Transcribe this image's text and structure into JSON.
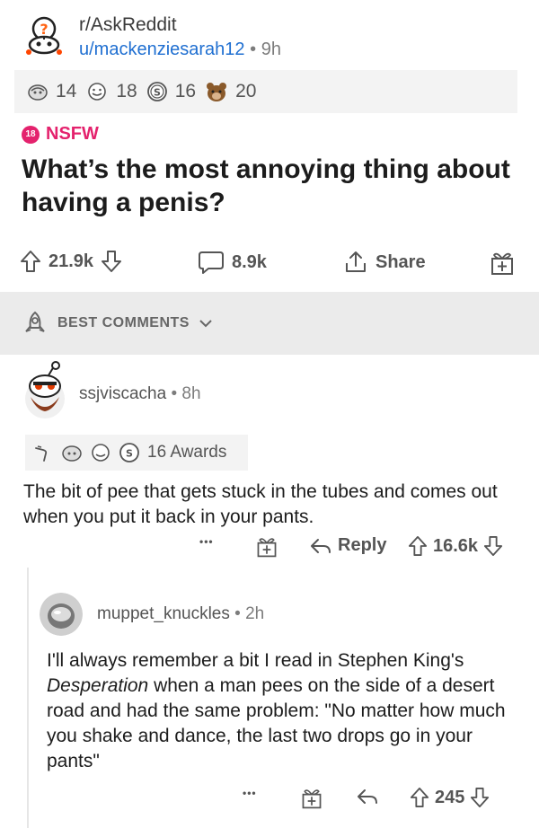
{
  "post": {
    "subreddit": "r/AskReddit",
    "author": "u/mackenziesarah12",
    "separator": "•",
    "age": "9h",
    "awards": [
      {
        "icon": "silver-award-icon",
        "count": "14"
      },
      {
        "icon": "wholesome-award-icon",
        "count": "18"
      },
      {
        "icon": "coin-award-icon",
        "count": "16"
      },
      {
        "icon": "bear-award-icon",
        "count": "20"
      }
    ],
    "nsfw_badge": "18",
    "nsfw_label": "NSFW",
    "title": "What’s the most annoying thing about having a penis?",
    "upvotes": "21.9k",
    "comments": "8.9k",
    "share_label": "Share"
  },
  "sort": {
    "label": "BEST COMMENTS"
  },
  "comment1": {
    "author": "ssjviscacha",
    "separator": "•",
    "age": "8h",
    "awards_label": "16 Awards",
    "body": "The bit of pee that gets stuck in the tubes and comes out when you put it back in your pants.",
    "more": "•••",
    "reply_label": "Reply",
    "score": "16.6k"
  },
  "comment2": {
    "author": "muppet_knuckles",
    "separator": "•",
    "age": "2h",
    "body_before": "I'll always remember a bit I read in Stephen King's ",
    "body_italic": "Desperation",
    "body_after": " when a man pees on the side of a desert road and had the same problem: \"No matter how much you shake and dance, the last two drops go in your pants\"",
    "more": "•••",
    "score": "245"
  },
  "colors": {
    "accent_blue": "#1f6fd1",
    "nsfw_pink": "#e4226d",
    "band_gray": "#ebebeb"
  }
}
